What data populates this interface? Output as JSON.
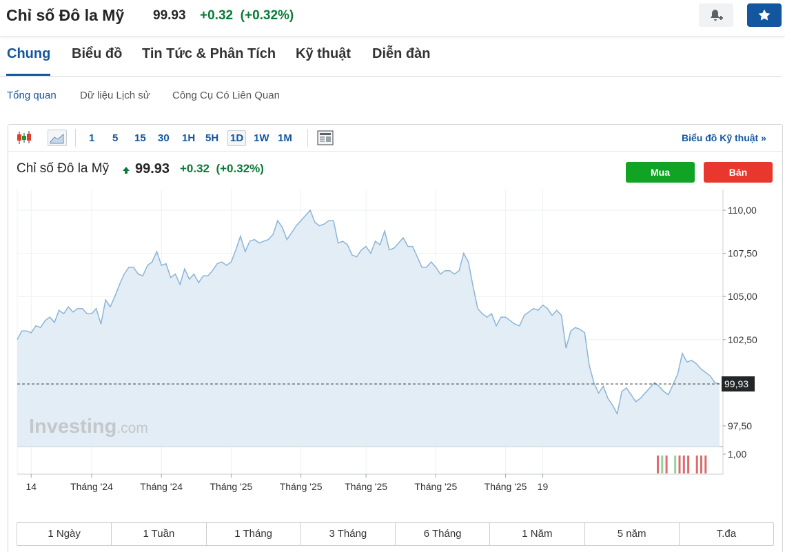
{
  "header": {
    "title": "Chỉ số Đô la Mỹ",
    "price": "99.93",
    "change": "+0.32",
    "change_pct": "(+0.32%)"
  },
  "tabs": [
    {
      "label": "Chung"
    },
    {
      "label": "Biểu đồ"
    },
    {
      "label": "Tin Tức & Phân Tích"
    },
    {
      "label": "Kỹ thuật"
    },
    {
      "label": "Diễn đàn"
    }
  ],
  "subtabs": [
    {
      "label": "Tổng quan"
    },
    {
      "label": "Dữ liệu Lịch sử"
    },
    {
      "label": "Công Cụ Có Liên Quan"
    }
  ],
  "toolbar": {
    "timeframes": [
      "1",
      "5",
      "15",
      "30",
      "1H",
      "5H",
      "1D",
      "1W",
      "1M"
    ],
    "active_timeframe": "1D",
    "tech_chart_link": "Biểu đồ Kỹ thuật »"
  },
  "chart_header": {
    "name": "Chỉ số Đô la Mỹ",
    "price": "99.93",
    "change": "+0.32",
    "change_pct": "(+0.32%)",
    "buy_label": "Mua",
    "sell_label": "Bán"
  },
  "watermark": {
    "brand": "Investing",
    "suffix": ".com"
  },
  "colors": {
    "accent": "#1256a0",
    "up": "#0a7b37",
    "buy": "#10a324",
    "sell": "#e8382d",
    "line": "#8ab4d8",
    "fill": "#e3edf6"
  },
  "chart_data": {
    "type": "area",
    "y_ticks": [
      "110,00",
      "107,50",
      "105,00",
      "102,50",
      "97,50"
    ],
    "y_tick_values": [
      110,
      107.5,
      105,
      102.5,
      97.5
    ],
    "ylim": [
      96.3,
      111.2
    ],
    "current_value": 99.93,
    "current_label": "99,93",
    "x_ticks": [
      "14",
      "Tháng '24",
      "Tháng '24",
      "Tháng '25",
      "Tháng '25",
      "Tháng '25",
      "Tháng '25",
      "Tháng '25",
      "19"
    ],
    "x_tick_index": [
      3,
      16,
      31,
      46,
      61,
      75,
      90,
      105,
      113
    ],
    "values": [
      102.5,
      103,
      103,
      102.9,
      103.3,
      103.2,
      103.6,
      103.8,
      103.5,
      104.2,
      104,
      104.4,
      104.1,
      104.3,
      104.3,
      104,
      104,
      104.3,
      103.4,
      104.8,
      104.4,
      105,
      105.7,
      106.3,
      106.7,
      106.7,
      106.3,
      106.2,
      106.8,
      107,
      107.6,
      106.8,
      106.9,
      106.1,
      106.3,
      105.7,
      106.6,
      106,
      106.3,
      105.8,
      106.2,
      106.2,
      106.5,
      106.9,
      107,
      106.8,
      107,
      107.7,
      108.5,
      107.6,
      108.2,
      108.3,
      108.1,
      108.2,
      108.3,
      108.6,
      109.4,
      109,
      108.3,
      108.7,
      109.1,
      109.4,
      109.7,
      110,
      109.3,
      109.1,
      109.2,
      109.4,
      109.4,
      108.1,
      108.2,
      108,
      107.4,
      107.3,
      107.7,
      107.9,
      107.5,
      108.2,
      108,
      108.8,
      107.7,
      107.8,
      108.1,
      108.4,
      107.9,
      107.9,
      107.3,
      106.7,
      106.7,
      107,
      106.7,
      106.3,
      106.5,
      106.5,
      106.3,
      106.5,
      107.5,
      107,
      105.6,
      104.3,
      104,
      103.8,
      104,
      103.3,
      103.8,
      103.8,
      103.6,
      103.4,
      103.3,
      103.9,
      104.1,
      104.3,
      104.2,
      104.5,
      104.3,
      103.9,
      104.2,
      103.9,
      102,
      103,
      103.2,
      103.1,
      102.9,
      101,
      100,
      99.4,
      99.8,
      99.1,
      98.7,
      98.2,
      99.5,
      99.7,
      99.3,
      98.9,
      99.1,
      99.4,
      99.7,
      100,
      99.8,
      99.5,
      99.3,
      99.9,
      100.5,
      101.7,
      101.2,
      101.3,
      101.1,
      100.8,
      100.6,
      100.4,
      100,
      99.93
    ],
    "volume_bars": [
      {
        "i": 0,
        "c": "r"
      },
      {
        "i": 1,
        "c": "g"
      },
      {
        "i": 2,
        "c": "r"
      },
      {
        "i": 4,
        "c": "g"
      },
      {
        "i": 5,
        "c": "r"
      },
      {
        "i": 6,
        "c": "r"
      },
      {
        "i": 7,
        "c": "r"
      },
      {
        "i": 9,
        "c": "r"
      },
      {
        "i": 10,
        "c": "r"
      },
      {
        "i": 11,
        "c": "r"
      }
    ],
    "volume_label": "1,00"
  },
  "ranges": [
    "1 Ngày",
    "1 Tuần",
    "1 Tháng",
    "3 Tháng",
    "6 Tháng",
    "1 Năm",
    "5 năm",
    "T.đa"
  ]
}
